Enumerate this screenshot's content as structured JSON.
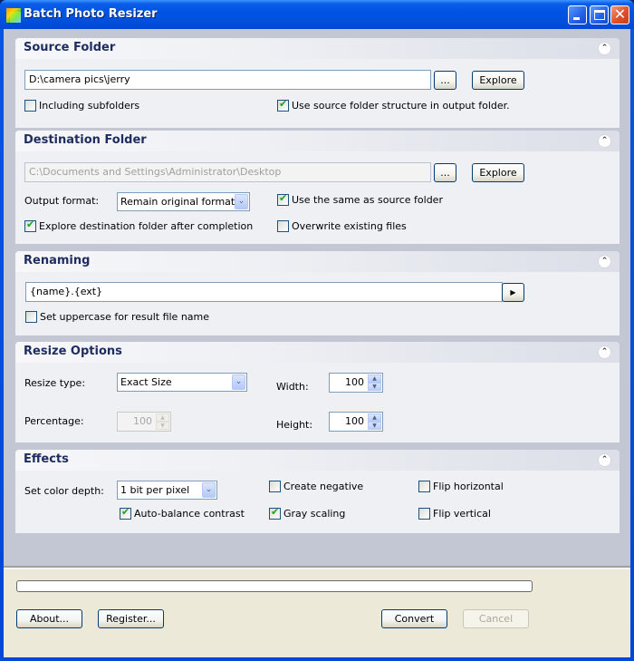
{
  "window": {
    "title": "Batch Photo Resizer",
    "controls": {
      "minimize": "minimize",
      "maximize": "maximize",
      "close": "✕"
    }
  },
  "source": {
    "title": "Source Folder",
    "path": "D:\\camera pics\\jerry",
    "browse_label": "...",
    "explore_label": "Explore",
    "include_subfolders": {
      "label": "Including subfolders",
      "checked": false
    },
    "use_structure": {
      "label": "Use source folder structure in output folder.",
      "checked": true
    }
  },
  "destination": {
    "title": "Destination Folder",
    "path": "C:\\Documents and Settings\\Administrator\\Desktop",
    "browse_label": "...",
    "explore_label": "Explore",
    "output_format_label": "Output format:",
    "output_format_value": "Remain original format",
    "same_as_source": {
      "label": "Use the same as source folder",
      "checked": true
    },
    "explore_after": {
      "label": "Explore destination folder after completion",
      "checked": true
    },
    "overwrite": {
      "label": "Overwrite existing files",
      "checked": false
    }
  },
  "renaming": {
    "title": "Renaming",
    "pattern": "{name}.{ext}",
    "arrow_label": "▶",
    "uppercase": {
      "label": "Set uppercase for result file name",
      "checked": false
    }
  },
  "resize": {
    "title": "Resize Options",
    "type_label": "Resize type:",
    "type_value": "Exact Size",
    "percentage_label": "Percentage:",
    "percentage_value": "100",
    "width_label": "Width:",
    "width_value": "100",
    "height_label": "Height:",
    "height_value": "100"
  },
  "effects": {
    "title": "Effects",
    "color_depth_label": "Set color depth:",
    "color_depth_value": "1 bit per pixel",
    "auto_balance": {
      "label": "Auto-balance contrast",
      "checked": true
    },
    "create_negative": {
      "label": "Create negative",
      "checked": false
    },
    "gray_scaling": {
      "label": "Gray scaling",
      "checked": true
    },
    "flip_horizontal": {
      "label": "Flip horizontal",
      "checked": false
    },
    "flip_vertical": {
      "label": "Flip vertical",
      "checked": false
    }
  },
  "footer": {
    "progress_percent": 0,
    "about_label": "About...",
    "register_label": "Register...",
    "convert_label": "Convert",
    "cancel_label": "Cancel"
  },
  "icons": {
    "collapse": "⌃",
    "dropdown": "⌄",
    "spin_up": "▲",
    "spin_down": "▼"
  }
}
